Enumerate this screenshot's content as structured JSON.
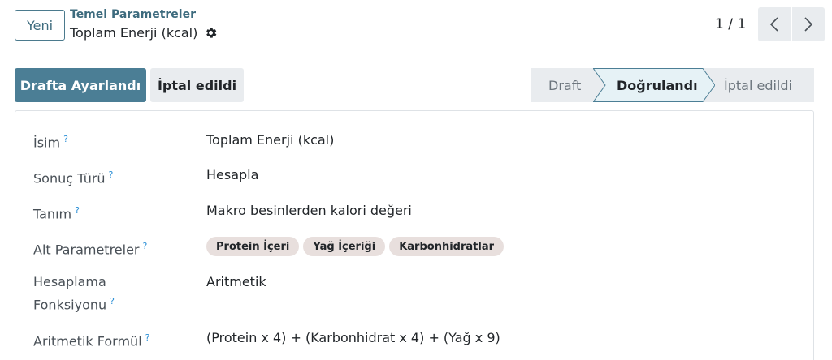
{
  "control_panel": {
    "new_button": "Yeni",
    "breadcrumb_parent": "Temel Parametreler",
    "breadcrumb_current": "Toplam Enerji (kcal)",
    "pager": "1 / 1"
  },
  "statusbar": {
    "draft_button": "Drafta Ayarlandı",
    "cancel_button": "İptal edildi",
    "stages": [
      "Draft",
      "Doğrulandı",
      "İptal edildi"
    ],
    "active_stage": "Doğrulandı"
  },
  "form": {
    "tooltip_mark": "?",
    "fields": {
      "name": {
        "label": "İsim",
        "value": "Toplam Enerji (kcal)"
      },
      "result_type": {
        "label": "Sonuç Türü",
        "value": "Hesapla"
      },
      "description": {
        "label": "Tanım",
        "value": "Makro besinlerden kalori değeri"
      },
      "sub_parameters": {
        "label": "Alt Parametreler",
        "tags": [
          "Protein İçeri",
          "Yağ İçeriği",
          "Karbonhidratlar"
        ]
      },
      "calc_function": {
        "label_line1": "Hesaplama",
        "label_line2": "Fonksiyonu",
        "value": "Aritmetik"
      },
      "formula": {
        "label": "Aritmetik Formül",
        "value": "(Protein x 4) + (Karbonhidrat x 4) + (Yağ x 9)"
      }
    }
  },
  "colors": {
    "primary": "#4b7e95",
    "link": "#3d6b7e",
    "tag_bg": "#e8dfdd",
    "tooltip": "#2b8fd6"
  }
}
